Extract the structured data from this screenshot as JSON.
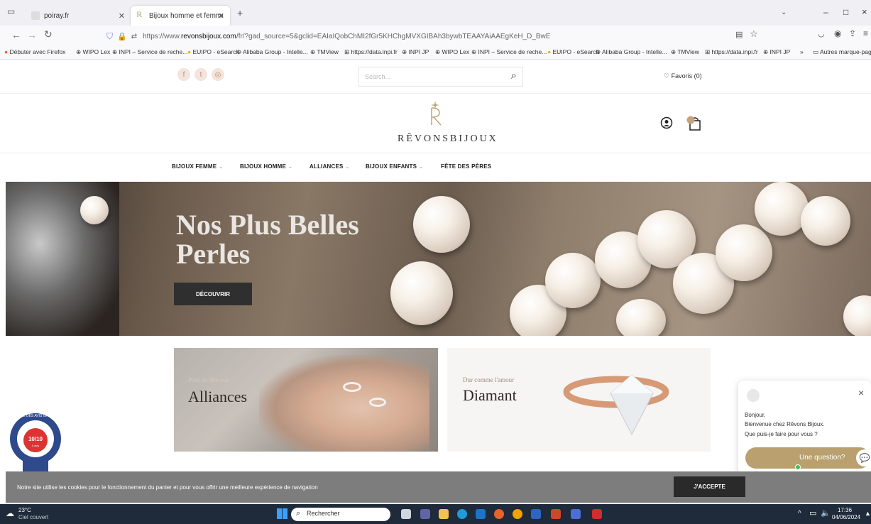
{
  "browser": {
    "tabs": [
      {
        "title": "poiray.fr",
        "active": false
      },
      {
        "title": "Bijoux homme et femme en or",
        "active": true
      }
    ],
    "new_tab": "+",
    "url_prefix": "https://www.",
    "url_domain": "revonsbijoux.com",
    "url_rest": "/fr/?gad_source=5&gclid=EAIaIQobChMI2fGr5KHChgMVXGIBAh3bywbTEAAYAiAAEgKeH_D_BwE",
    "window_controls": [
      "–",
      "□",
      "×"
    ],
    "bookmarks": [
      "Débuter avec Firefox",
      "WIPO Lex",
      "INPI – Service de reche...",
      "EUIPO - eSearch",
      "Alibaba Group - Intelle...",
      "TMView",
      "https://data.inpi.fr",
      "INPI JP",
      "WIPO Lex",
      "INPI – Service de reche...",
      "EUIPO - eSearch",
      "Alibaba Group - Intelle...",
      "TMView",
      "https://data.inpi.fr",
      "INPI JP"
    ],
    "more_bookmarks": "»",
    "other_bookmarks": "Autres marque-page"
  },
  "site": {
    "search_placeholder": "Search...",
    "favoris": "♡ Favoris (0)",
    "logo_text": "RÊVONSBIJOUX",
    "menu": [
      {
        "label": "BIJOUX FEMME",
        "chevron": true
      },
      {
        "label": "BIJOUX HOMME",
        "chevron": true
      },
      {
        "label": "ALLIANCES",
        "chevron": true
      },
      {
        "label": "BIJOUX ENFANTS",
        "chevron": true
      },
      {
        "label": "FÊTE DES PÈRES",
        "chevron": false
      }
    ],
    "hero": {
      "title_line1": "Nos Plus Belles",
      "title_line2": "Perles",
      "button": "DÉCOUVRIR"
    },
    "tiles": [
      {
        "small": "Pour se dire oui",
        "big": "Alliances"
      },
      {
        "small": "Dur comme l'amour",
        "big": "Diamant"
      }
    ]
  },
  "chat": {
    "line1": "Bonjour,",
    "line2": "Bienvenue chez Rêvons Bijoux.",
    "line3": "Que puis-je faire pour vous ?",
    "button": "Une question?",
    "close": "×"
  },
  "badge": {
    "ring_text": "SOCIÉTÉ DES AVIS GARANTIS",
    "score": "10/10",
    "sub": "5 avis"
  },
  "cookie": {
    "message": "Notre site utilise les cookies pour le fonctionnement du panier et pour vous offrir une meilleure expérience de navigation",
    "button": "J'ACCEPTE"
  },
  "taskbar": {
    "temp": "23°C",
    "weather": "Ciel couvert",
    "search": "Rechercher",
    "time": "17:36",
    "date": "04/06/2024"
  },
  "colors": {
    "accent_gold": "#b9a06e",
    "cookie_bar": "#7d7d7d",
    "taskbar": "#1f2a3a"
  }
}
